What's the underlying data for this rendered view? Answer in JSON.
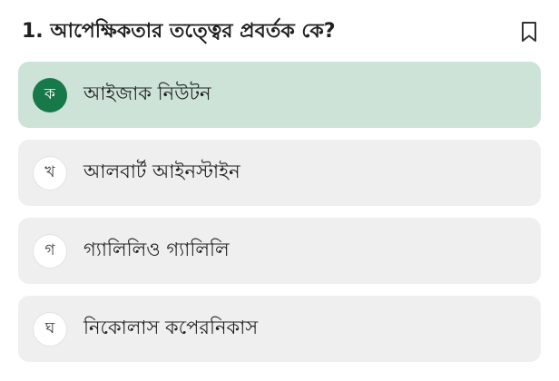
{
  "question": {
    "text": "1. আপেক্ষিকতার তত্ত্বের প্রবর্তক কে?"
  },
  "bookmark": {
    "icon": "bookmark-icon"
  },
  "options": [
    {
      "letter": "ক",
      "text": "আইজাক নিউটন",
      "selected": true
    },
    {
      "letter": "খ",
      "text": "আলবার্ট আইনস্টাইন",
      "selected": false
    },
    {
      "letter": "গ",
      "text": "গ্যালিলিও গ্যালিলি",
      "selected": false
    },
    {
      "letter": "ঘ",
      "text": "নিকোলাস কপেরনিকাস",
      "selected": false
    }
  ],
  "colors": {
    "selected_background": "#cde3d7",
    "selected_badge": "#17784a",
    "option_background": "#efefef"
  }
}
